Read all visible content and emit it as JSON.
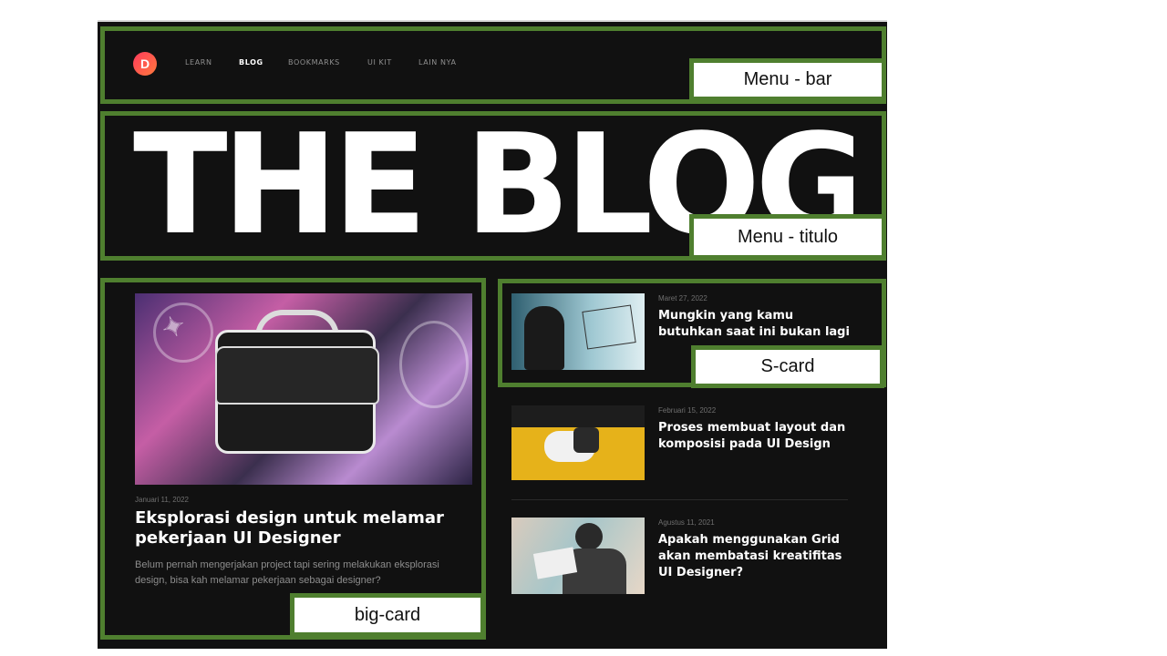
{
  "nav": {
    "logo": "D",
    "links": [
      "LEARN",
      "BLOG",
      "BOOKMARKS",
      "UI KIT",
      "LAIN NYA"
    ],
    "active": "BLOG"
  },
  "hero": {
    "title": "THE BLOG"
  },
  "big_card": {
    "date": "Januari 11, 2022",
    "title": "Eksplorasi design untuk melamar pekerjaan UI Designer",
    "description": "Belum pernah mengerjakan project tapi sering melakukan eksplorasi design, bisa kah melamar pekerjaan sebagai designer?"
  },
  "small_cards": [
    {
      "date": "Maret 27, 2022",
      "title": "Mungkin yang kamu butuhkan saat ini bukan lagi latihan ketrampilan desain"
    },
    {
      "date": "Februari 15, 2022",
      "title": "Proses membuat layout dan komposisi pada UI Design"
    },
    {
      "date": "Agustus 11, 2021",
      "title": "Apakah menggunakan Grid akan membatasi kreatifitas UI Designer?"
    }
  ],
  "annotations": {
    "menu_bar": "Menu - bar",
    "menu_titulo": "Menu - titulo",
    "s_card": "S-card",
    "big_card": "big-card"
  },
  "colors": {
    "annotation": "#4f7f2f",
    "background": "#111111",
    "logo_gradient_start": "#ff3b5c",
    "logo_gradient_end": "#ff7a3d"
  }
}
